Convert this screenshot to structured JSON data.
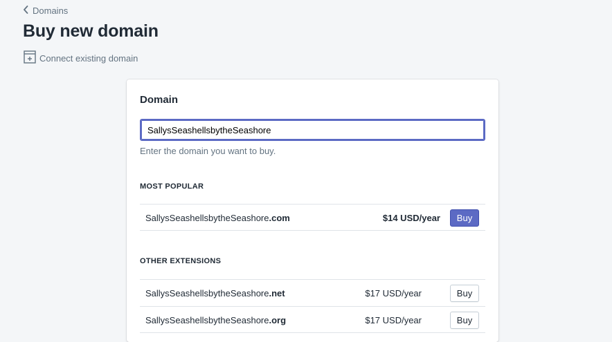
{
  "breadcrumb": {
    "label": "Domains"
  },
  "page": {
    "title": "Buy new domain",
    "secondary_action": "Connect existing domain"
  },
  "card": {
    "title": "Domain",
    "input_value": "SallysSeashellsbytheSeashore",
    "help_text": "Enter the domain you want to buy.",
    "most_popular": {
      "heading": "MOST POPULAR",
      "items": [
        {
          "base": "SallysSeashellsbytheSeashore",
          "tld": ".com",
          "price": "$14 USD/year",
          "button": "Buy"
        }
      ]
    },
    "other_extensions": {
      "heading": "OTHER EXTENSIONS",
      "items": [
        {
          "base": "SallysSeashellsbytheSeashore",
          "tld": ".net",
          "price": "$17 USD/year",
          "button": "Buy"
        },
        {
          "base": "SallysSeashellsbytheSeashore",
          "tld": ".org",
          "price": "$17 USD/year",
          "button": "Buy"
        }
      ]
    }
  },
  "colors": {
    "accent": "#5c6ac4",
    "background": "#f4f6f8",
    "text": "#212b36",
    "subdued": "#637381"
  },
  "icons": {
    "back": "chevron-left-icon",
    "connect": "add-domain-icon"
  }
}
